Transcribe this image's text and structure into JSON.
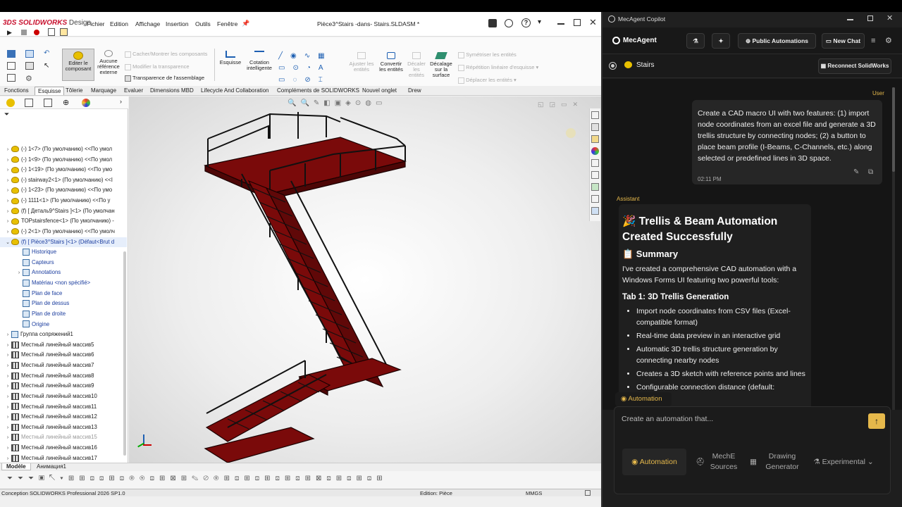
{
  "solidworks": {
    "logo": "3DS",
    "brand": "SOLIDWORKS",
    "brand_suffix": "Design",
    "menu": [
      "Fichier",
      "Edition",
      "Affichage",
      "Insertion",
      "Outils",
      "Fenêtre"
    ],
    "doc_title": "Pièce3^Stairs -dans- Stairs.SLDASM *",
    "commands": {
      "edit_component": "Editer le composant",
      "no_ext_ref": "Aucune référence externe",
      "hide_show": "Cacher/Montrer les composants",
      "modify_transparency": "Modifier la transparence",
      "assembly_transparency": "Transparence de l'assemblage",
      "sketch": "Esquisse",
      "smart_dim": "Cotation intelligente",
      "trim": "Ajuster les entités",
      "convert": "Convertir les entités",
      "offset": "Décaler les entités",
      "surface_offset": "Décalage sur la surface",
      "mirror": "Symétriser les entités",
      "linear_pattern": "Répétition linéaire d'esquisse",
      "move": "Déplacer les entités"
    },
    "tabs": [
      "Fonctions",
      "Esquisse",
      "Tôlerie",
      "Marquage",
      "Evaluer",
      "Dimensions MBD",
      "Lifecycle And Collaboration",
      "Compléments de SOLIDWORKS",
      "Nouvel onglet",
      "Drew"
    ],
    "active_tab": "Esquisse",
    "tree": [
      {
        "label": "(-) 1<7> (По умолчанию) <<По умол",
        "type": "y",
        "indent": 0
      },
      {
        "label": "(-) 1<9> (По умолчанию) <<По умол",
        "type": "y",
        "indent": 0
      },
      {
        "label": "(-) 1<19> (По умолчанию) <<По умо",
        "type": "y",
        "indent": 0
      },
      {
        "label": "(-) stairway2<1> (По умолчанию) <<І",
        "type": "y",
        "indent": 0
      },
      {
        "label": "(-) 1<23> (По умолчанию) <<По умо",
        "type": "y",
        "indent": 0
      },
      {
        "label": "(-) 1111<1> (По умолчанию) <<По у",
        "type": "y",
        "indent": 0
      },
      {
        "label": "(f) [ Деталь9^Stairs ]<1> (По умолчан",
        "type": "y",
        "indent": 0
      },
      {
        "label": "TOPstairsfence<1> (По умолчанию) -",
        "type": "y",
        "indent": 0
      },
      {
        "label": "(-) 2<1> (По умолчанию) <<По умолч",
        "type": "y",
        "indent": 0
      },
      {
        "label": "(f) [ Pièce3^Stairs ]<1> (Défaut<Brut d",
        "type": "y",
        "indent": 0,
        "open": true,
        "blue": true
      },
      {
        "label": "Historique",
        "type": "b",
        "indent": 1,
        "blue": true
      },
      {
        "label": "Capteurs",
        "type": "b",
        "indent": 1,
        "blue": true
      },
      {
        "label": "Annotations",
        "type": "b",
        "indent": 1,
        "blue": true,
        "arrow": true
      },
      {
        "label": "Matériau <non spécifié>",
        "type": "b",
        "indent": 1,
        "blue": true
      },
      {
        "label": "Plan de face",
        "type": "b",
        "indent": 1,
        "blue": true
      },
      {
        "label": "Plan de dessus",
        "type": "b",
        "indent": 1,
        "blue": true
      },
      {
        "label": "Plan de droite",
        "type": "b",
        "indent": 1,
        "blue": true
      },
      {
        "label": "Origine",
        "type": "b",
        "indent": 1,
        "blue": true
      },
      {
        "label": "Группа сопряжений1",
        "type": "b",
        "indent": 0
      },
      {
        "label": "Местный линейный массив5",
        "type": "g",
        "indent": 0
      },
      {
        "label": "Местный линейный массив6",
        "type": "g",
        "indent": 0
      },
      {
        "label": "Местный линейный массив7",
        "type": "g",
        "indent": 0
      },
      {
        "label": "Местный линейный массив8",
        "type": "g",
        "indent": 0
      },
      {
        "label": "Местный линейный массив9",
        "type": "g",
        "indent": 0
      },
      {
        "label": "Местный линейный массив10",
        "type": "g",
        "indent": 0
      },
      {
        "label": "Местный линейный массив11",
        "type": "g",
        "indent": 0
      },
      {
        "label": "Местный линейный массив12",
        "type": "g",
        "indent": 0
      },
      {
        "label": "Местный линейный массив13",
        "type": "g",
        "indent": 0
      },
      {
        "label": "Местный линейный массив15",
        "type": "g",
        "indent": 0,
        "grey": true
      },
      {
        "label": "Местный линейный массив16",
        "type": "g",
        "indent": 0
      },
      {
        "label": "Местный линейный массив17",
        "type": "g",
        "indent": 0
      }
    ],
    "bottom_tabs": [
      "Modèle",
      "Анимация1"
    ],
    "status_left": "Conception SOLIDWORKS Professional 2026 SP1.0",
    "status_mid": "Edition: Pièce",
    "status_units": "MMGS"
  },
  "mecagent": {
    "window_title": "MecAgent Copilot",
    "logo": "MecAgent",
    "public_automations": "Public Automations",
    "new_chat": "New Chat",
    "project": "Stairs",
    "reconnect": "Reconnect SolidWorks",
    "user_role": "User",
    "user_message": "Create a CAD macro UI with two features: (1) import node coordinates from an excel file and generate a 3D trellis structure by connecting nodes; (2) a button to place beam profile (I-Beams, C-Channels, etc.) along selected or predefined lines in 3D space.",
    "user_time": "02:11 PM",
    "assistant_role": "Assistant",
    "heading": "🎉 Trellis & Beam Automation Created Successfully",
    "summary_heading": "📋 Summary",
    "summary_text": "I've created a comprehensive CAD automation with a Windows Forms UI featuring two powerful tools:",
    "tab1_heading": "Tab 1: 3D Trellis Generation",
    "bullets": [
      "Import node coordinates from CSV files (Excel-compatible format)",
      "Real-time data preview in an interactive grid",
      "Automatic 3D trellis structure generation by connecting nearby nodes",
      "Creates a 3D sketch with reference points and lines",
      "Configurable connection distance (default:"
    ],
    "automation_chip": "Automation",
    "input_placeholder": "Create an automation that...",
    "modes": [
      {
        "label": "Automation",
        "active": true
      },
      {
        "label": "MechE Sources",
        "active": false
      },
      {
        "label": "Drawing Generator",
        "active": false
      },
      {
        "label": "Experimental",
        "active": false
      }
    ],
    "accent": "#e5b84b"
  }
}
